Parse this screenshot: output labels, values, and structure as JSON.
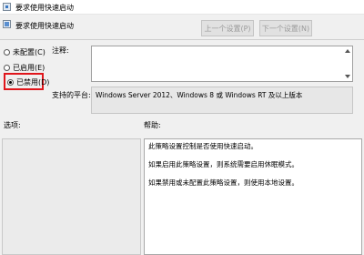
{
  "window": {
    "title": "要求使用快速启动"
  },
  "header": {
    "title": "要求使用快速启动"
  },
  "nav": {
    "prev_label": "上一个设置(P)",
    "next_label": "下一个设置(N)"
  },
  "options": [
    {
      "label": "未配置(C)",
      "checked": false
    },
    {
      "label": "已启用(E)",
      "checked": false
    },
    {
      "label": "已禁用(D)",
      "checked": true
    }
  ],
  "highlight_color": "#e0161c",
  "comment": {
    "label": "注释:",
    "value": ""
  },
  "platform": {
    "label": "支持的平台:",
    "value": "Windows Server 2012、Windows 8 或 Windows RT 及以上版本"
  },
  "sections": {
    "options_label": "选项:",
    "help_label": "帮助:"
  },
  "help": {
    "paragraphs": [
      "此策略设置控制是否使用快速启动。",
      "如果启用此策略设置，则系统需要启用休眠模式。",
      "如果禁用或未配置此策略设置，则使用本地设置。"
    ]
  }
}
